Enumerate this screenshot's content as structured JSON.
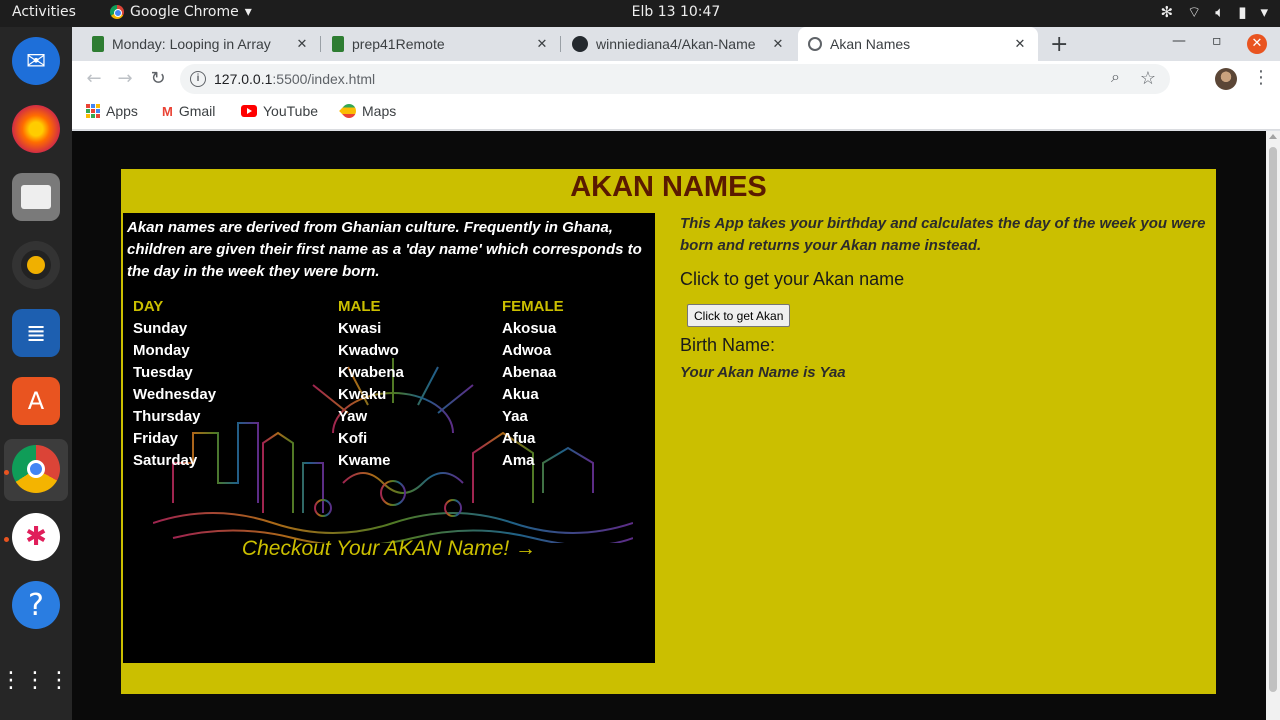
{
  "system": {
    "activities": "Activities",
    "app_name": "Google Chrome",
    "clock": "Elb 13  10:47"
  },
  "browser": {
    "tabs": [
      {
        "title": "Monday: Looping in Array",
        "active": false
      },
      {
        "title": "prep41Remote",
        "active": false
      },
      {
        "title": "winniediana4/Akan-Name",
        "active": false
      },
      {
        "title": "Akan Names",
        "active": true
      }
    ],
    "url_host": "127.0.0.1",
    "url_path": ":5500/index.html",
    "bookmarks": [
      {
        "label": "Apps"
      },
      {
        "label": "Gmail"
      },
      {
        "label": "YouTube"
      },
      {
        "label": "Maps"
      }
    ]
  },
  "page": {
    "title": "AKAN NAMES",
    "intro": "Akan names are derived from Ghanian culture. Frequently in Ghana, children are given their first name as a 'day name' which corresponds to the day in the week they were born.",
    "table": {
      "headers": [
        "DAY",
        "MALE",
        "FEMALE"
      ],
      "rows": [
        [
          "Sunday",
          "Kwasi",
          "Akosua"
        ],
        [
          "Monday",
          "Kwadwo",
          "Adwoa"
        ],
        [
          "Tuesday",
          "Kwabena",
          "Abenaa"
        ],
        [
          "Wednesday",
          "Kwaku",
          "Akua"
        ],
        [
          "Thursday",
          "Yaw",
          "Yaa"
        ],
        [
          "Friday",
          "Kofi",
          "Afua"
        ],
        [
          "Saturday",
          "Kwame",
          "Ama"
        ]
      ]
    },
    "cta": "Checkout Your AKAN Name! →",
    "description": "This App takes your birthday and calculates the day of the week you were born and returns your Akan name instead.",
    "click_text": "Click to get your Akan name",
    "button_label": "Click to get Akan",
    "birth_label": "Birth Name:",
    "result": "Your Akan Name is Yaa"
  },
  "colors": {
    "page_bg": "#cbbf00",
    "title_color": "#5a1a00",
    "panel_bg": "#000000",
    "accent": "#cbbf00"
  }
}
